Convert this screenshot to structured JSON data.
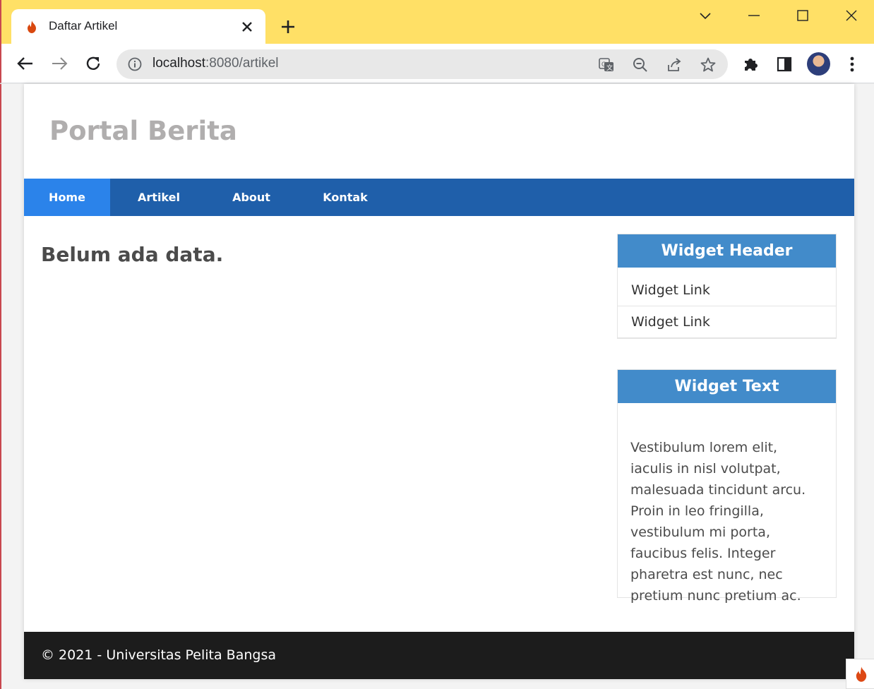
{
  "browser": {
    "tab_title": "Daftar Artikel",
    "url_host": "localhost",
    "url_path": ":8080/artikel",
    "icons": [
      "flame-icon",
      "close-icon",
      "plus-icon",
      "chevron-down-icon",
      "minimize-icon",
      "maximize-icon",
      "window-close-icon",
      "back-icon",
      "forward-icon",
      "reload-icon",
      "info-icon",
      "translate-icon",
      "zoom-out-icon",
      "share-icon",
      "star-icon",
      "extensions-icon",
      "side-panel-icon",
      "avatar",
      "more-icon"
    ],
    "accent_color": "#ffe066"
  },
  "site": {
    "title": "Portal Berita",
    "nav": [
      {
        "label": "Home",
        "active": true
      },
      {
        "label": "Artikel",
        "active": false
      },
      {
        "label": "About",
        "active": false
      },
      {
        "label": "Kontak",
        "active": false
      }
    ],
    "nav_color": "#1f5faa",
    "nav_active_color": "#2b83ea"
  },
  "main": {
    "message": "Belum ada data."
  },
  "sidebar": {
    "widget1": {
      "header": "Widget Header",
      "links": [
        "Widget Link",
        "Widget Link"
      ]
    },
    "widget2": {
      "header": "Widget Text",
      "text": "Vestibulum lorem elit, iaculis in nisl volutpat, malesuada tincidunt arcu. Proin in leo fringilla, vestibulum mi porta, faucibus felis. Integer pharetra est nunc, nec pretium nunc pretium ac."
    },
    "header_color": "#428bca"
  },
  "footer": {
    "text": "© 2021 - Universitas Pelita Bangsa"
  }
}
